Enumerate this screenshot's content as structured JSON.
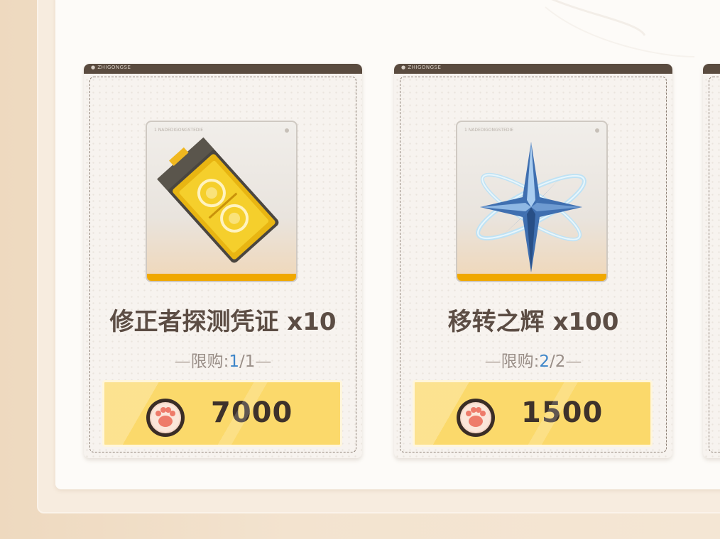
{
  "cards": [
    {
      "topbar_text": "● ZHIGONGSE",
      "frame_label": "1 NADEDIGONGSTEDIE",
      "item_name": "修正者探测凭证 x10",
      "limit_prefix": "限购:",
      "limit_current": "1",
      "limit_total": "/1",
      "price": "7000",
      "icon": "yellow-chip-icon"
    },
    {
      "topbar_text": "● ZHIGONGSE",
      "frame_label": "1 NADEDIGONGSTEDIE",
      "item_name": "移转之辉 x100",
      "limit_prefix": "限购:",
      "limit_current": "2",
      "limit_total": "/2",
      "price": "1500",
      "icon": "star-crystal-icon"
    }
  ],
  "currency_icon": "paw-coin-icon",
  "colors": {
    "card_topbar": "#5a4b3f",
    "price_button": "#fbd96b",
    "item_accent": "#f0a800",
    "limit_current": "#3e86c9"
  }
}
